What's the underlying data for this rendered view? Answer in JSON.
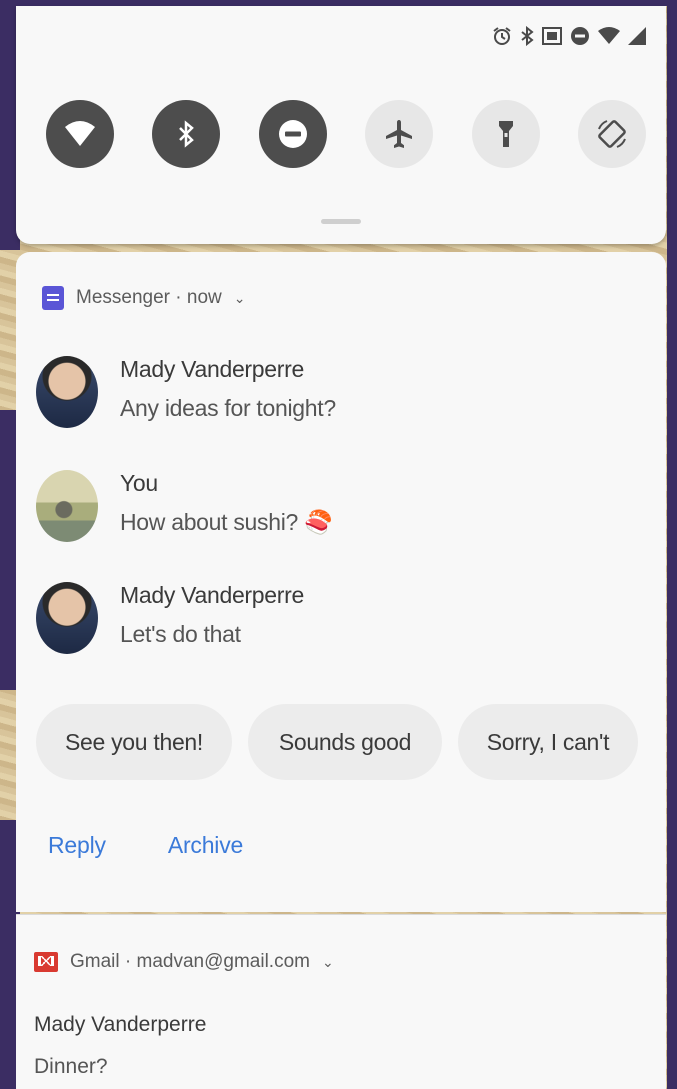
{
  "status_bar": {
    "icons": [
      "alarm-icon",
      "bluetooth-icon",
      "cast-icon",
      "do-not-disturb-icon",
      "wifi-icon",
      "signal-icon"
    ]
  },
  "quick_settings": {
    "tiles": [
      {
        "name": "wifi",
        "state": "on"
      },
      {
        "name": "bluetooth",
        "state": "on"
      },
      {
        "name": "do-not-disturb",
        "state": "on"
      },
      {
        "name": "airplane-mode",
        "state": "off"
      },
      {
        "name": "flashlight",
        "state": "off"
      },
      {
        "name": "auto-rotate",
        "state": "off"
      }
    ]
  },
  "messenger": {
    "app_name": "Messenger",
    "time": "· now",
    "messages": [
      {
        "sender": "Mady Vanderperre",
        "text": "Any ideas for tonight?"
      },
      {
        "sender": "You",
        "text": "How about sushi? 🍣"
      },
      {
        "sender": "Mady Vanderperre",
        "text": "Let's do that"
      }
    ],
    "smart_replies": [
      "See you then!",
      "Sounds good",
      "Sorry, I can't"
    ],
    "actions": {
      "reply": "Reply",
      "archive": "Archive"
    }
  },
  "gmail": {
    "app_name": "Gmail",
    "account": "· madvan@gmail.com",
    "sender": "Mady Vanderperre",
    "subject": "Dinner?"
  },
  "colors": {
    "accent": "#3b7ad9",
    "tile_on": "#4d4d4d",
    "tile_off": "#e7e7e7",
    "messenger_icon": "#5a55d6",
    "gmail_icon": "#d93a31"
  }
}
